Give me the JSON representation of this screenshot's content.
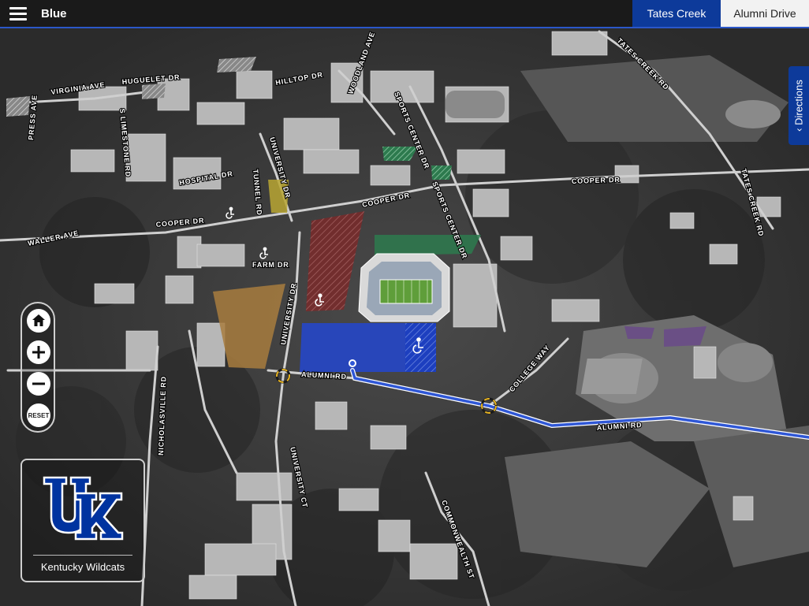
{
  "header": {
    "title": "Blue",
    "menu_icon": "hamburger-menu-icon",
    "tabs": [
      {
        "label": "Tates Creek",
        "active": true
      },
      {
        "label": "Alumni Drive",
        "active": false
      }
    ]
  },
  "directions_tab": {
    "label": "Directions",
    "icon": "chevron-up-icon"
  },
  "map_controls": {
    "home_icon": "home-icon",
    "zoom_in_icon": "plus-icon",
    "zoom_out_icon": "minus-icon",
    "reset_label": "RESET"
  },
  "logo": {
    "letters": "UK",
    "caption": "Kentucky Wildcats"
  },
  "street_labels": {
    "virginia_ave": "VIRGINIA AVE",
    "press_ave": "PRESS AVE",
    "huguelet_dr": "HUGUELET DR",
    "hilltop_dr": "HILLTOP DR",
    "woodland_ave": "WOODLAND AVE",
    "limestone": "S LIMESTONE RD",
    "university_dr_north": "UNIVERSITY DR",
    "hospital_dr": "HOSPITAL DR",
    "tunnel_rd": "TUNNEL RD",
    "sports_center_dr_north": "SPORTS CENTER DR",
    "sports_center_dr_south": "SPORTS CENTER DR",
    "cooper_dr_west": "COOPER DR",
    "cooper_dr_center": "COOPER DR",
    "cooper_dr_east": "COOPER DR",
    "waller_ave": "WALLER AVE",
    "farm_dr": "FARM DR",
    "university_dr_south": "UNIVERSITY DR",
    "tates_creek_rd_north": "TATES CREEK RD",
    "tates_creek_rd_east": "TATES CREEK RD",
    "alumni_rd_west": "ALUMNI RD",
    "alumni_rd_east": "ALUMNI RD",
    "college_way": "COLLEGE WAY",
    "nicholasville_rd": "NICHOLASVILLE RD",
    "university_ct": "UNIVERSITY CT",
    "commonwealth_st": "COMMONWEALTH ST"
  },
  "colors": {
    "header_bg": "#1a1a1a",
    "accent_blue": "#0d3a9a",
    "lot_blue": "#2646c4",
    "lot_red": "#7a2a2a",
    "lot_green": "#2d7a4e",
    "lot_tan": "#a87c3e",
    "lot_yellow": "#b8a632",
    "lot_purple": "#6a4a8a",
    "route_blue": "#2f57d6",
    "uk_blue": "#0033a0"
  }
}
